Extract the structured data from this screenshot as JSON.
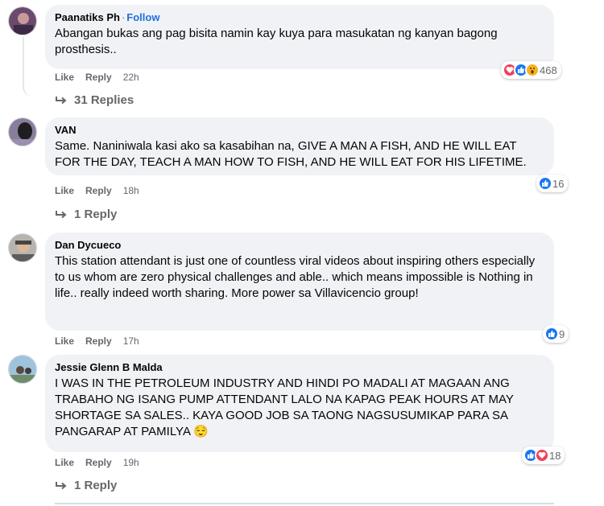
{
  "comments": [
    {
      "author": "Paanatiks Ph",
      "follow": "Follow",
      "text": "Abangan bukas ang pag bisita namin kay kuya para masukatan ng kanyan bagong prosthesis..",
      "like_label": "Like",
      "reply_label": "Reply",
      "time": "22h",
      "reaction_icons": [
        "love-icon",
        "like-icon",
        "wow-icon"
      ],
      "reaction_count": "468",
      "replies_label": "31 Replies"
    },
    {
      "author": "VAN",
      "text": "Same. Naniniwala kasi ako sa kasabihan na, GIVE A MAN A FISH, AND HE WILL EAT FOR THE DAY, TEACH A MAN HOW TO FISH, AND HE WILL EAT FOR HIS LIFETIME.",
      "like_label": "Like",
      "reply_label": "Reply",
      "time": "18h",
      "reaction_icons": [
        "like-icon"
      ],
      "reaction_count": "16",
      "replies_label": "1 Reply"
    },
    {
      "author": "Dan Dycueco",
      "text": "This station attendant is just one of countless viral videos about inspiring others especially to us whom are zero physical challenges and able.. which means impossible is Nothing in life.. really indeed worth sharing. More power sa Villavicencio group!",
      "like_label": "Like",
      "reply_label": "Reply",
      "time": "17h",
      "reaction_icons": [
        "like-icon"
      ],
      "reaction_count": "9"
    },
    {
      "author": "Jessie Glenn B Malda",
      "text": "I WAS IN THE PETROLEUM INDUSTRY AND HINDI PO MADALI AT MAGAAN ANG TRABAHO NG ISANG PUMP ATTENDANT LALO NA KAPAG PEAK HOURS AT MAY SHORTAGE SA SALES.. KAYA GOOD JOB SA TAONG NAGSUSUMIKAP PARA SA PANGARAP AT PAMILYA",
      "emoji": "😌",
      "like_label": "Like",
      "reply_label": "Reply",
      "time": "19h",
      "reaction_icons": [
        "like-icon",
        "love-icon"
      ],
      "reaction_count": "18",
      "replies_label": "1 Reply"
    }
  ],
  "colors": {
    "bubble": "#f0f2f5",
    "secondary_text": "#65676b",
    "follow_blue": "#216fdb",
    "like_blue": "#1877f2",
    "love_red": "#f33e58",
    "wow_yellow": "#f7b125"
  }
}
